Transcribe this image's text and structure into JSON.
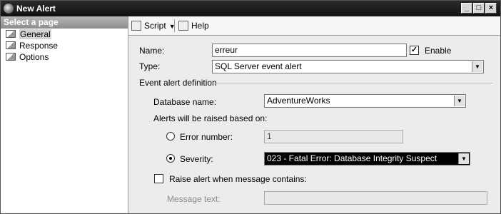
{
  "window": {
    "title": "New Alert",
    "controls": {
      "minimize": "_",
      "maximize": "□",
      "close": "×"
    }
  },
  "sidebar": {
    "header": "Select a page",
    "items": [
      {
        "label": "General",
        "selected": true
      },
      {
        "label": "Response",
        "selected": false
      },
      {
        "label": "Options",
        "selected": false
      }
    ]
  },
  "toolbar": {
    "script_label": "Script",
    "help_label": "Help"
  },
  "form": {
    "name_label": "Name:",
    "name_value": "erreur",
    "enable_label": "Enable",
    "enable_checked": true,
    "type_label": "Type:",
    "type_value": "SQL Server event alert",
    "section_label": "Event alert definition",
    "database_label": "Database name:",
    "database_value": "AdventureWorks",
    "alerts_based_on_label": "Alerts will be raised based on:",
    "error_number_label": "Error number:",
    "error_number_value": "1",
    "severity_label": "Severity:",
    "severity_value": "023 - Fatal Error: Database Integrity Suspect",
    "selected_option": "severity",
    "raise_alert_label": "Raise alert when message contains:",
    "raise_alert_checked": false,
    "message_text_label": "Message text:",
    "message_text_value": ""
  },
  "icons": {
    "app": "sql-alert-icon",
    "page": "page-icon",
    "script": "script-icon",
    "help": "help-icon",
    "dropdown": "chevron-down-icon"
  }
}
